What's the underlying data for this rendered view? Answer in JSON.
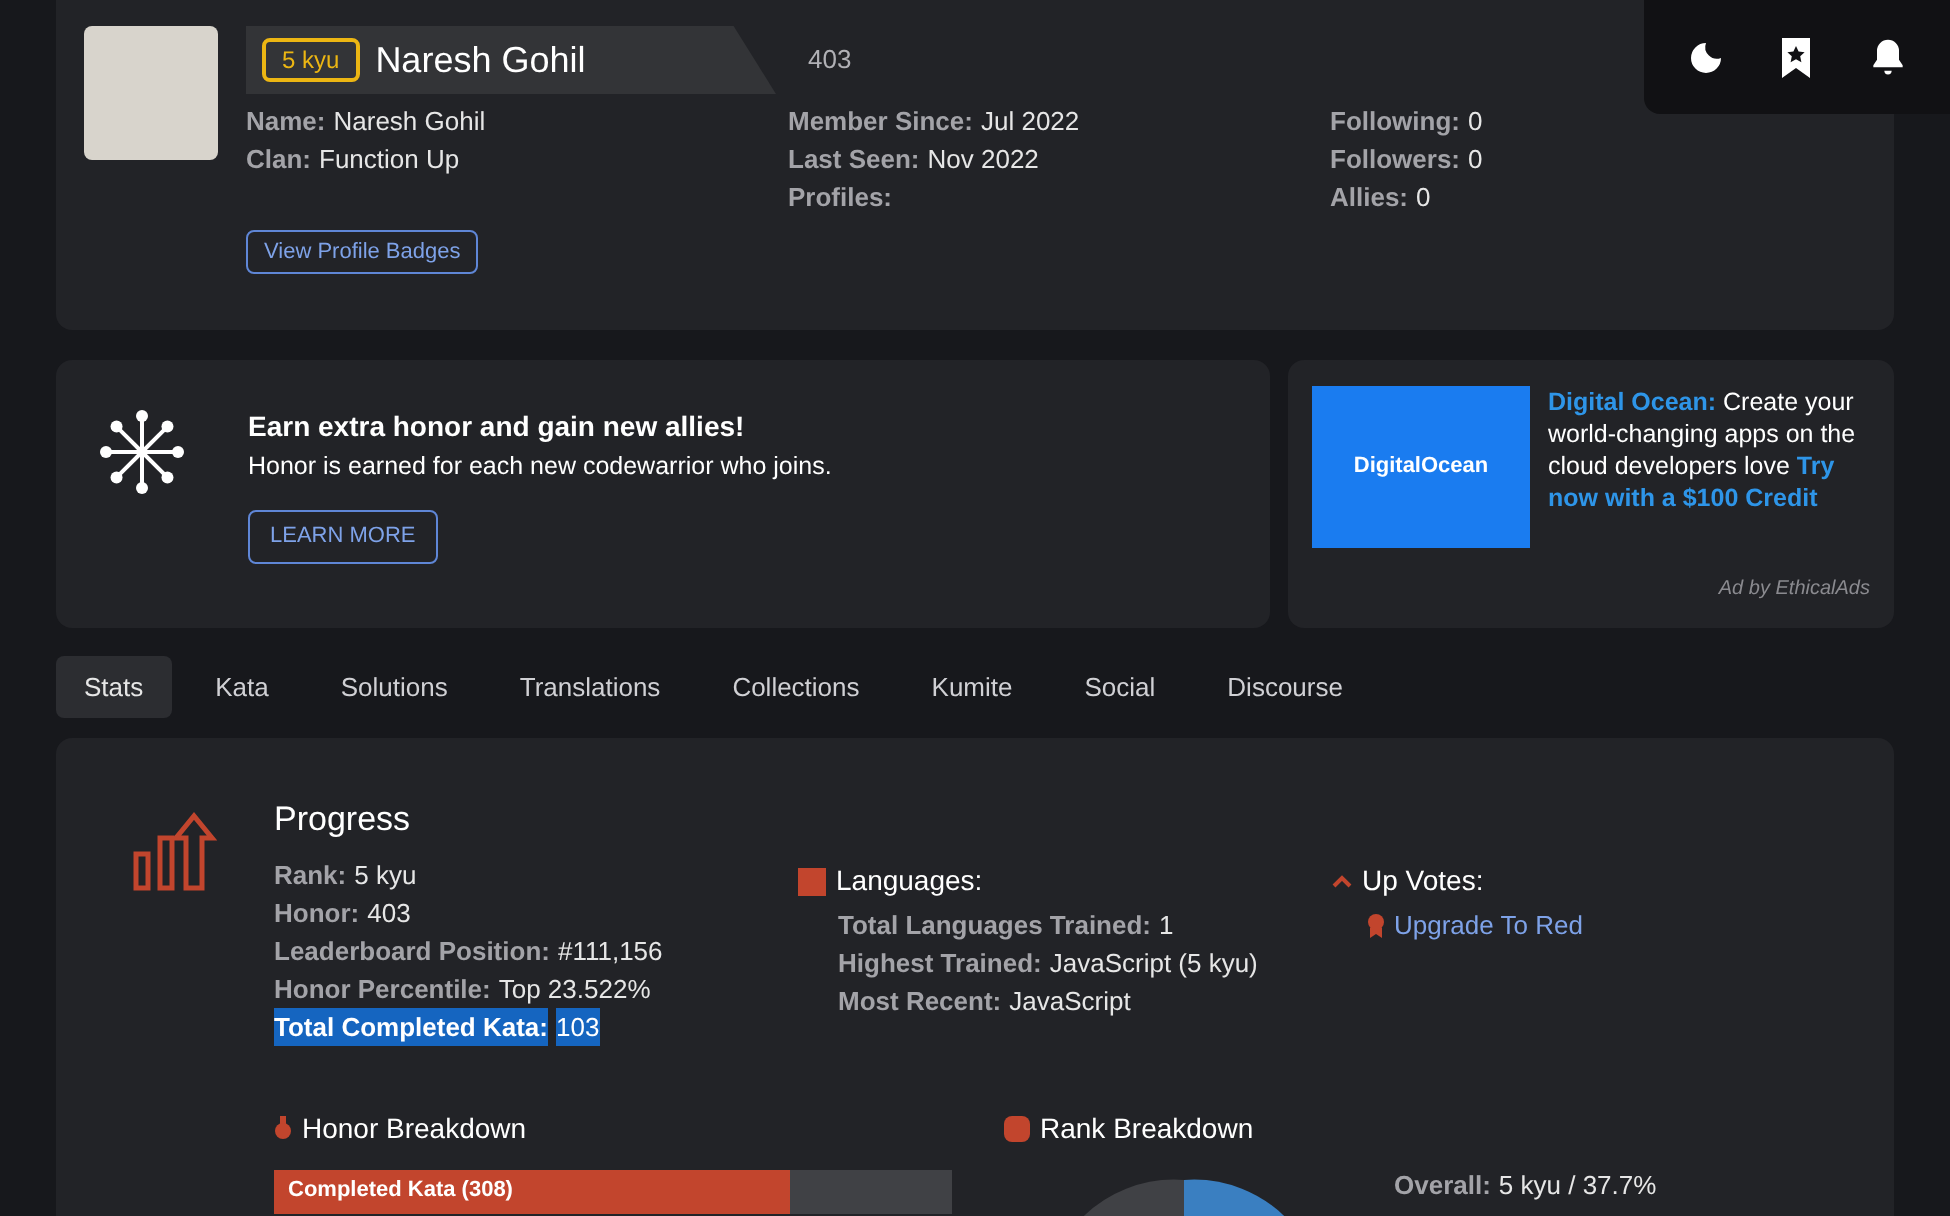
{
  "profile": {
    "rank_badge": "5 kyu",
    "display_name": "Naresh Gohil",
    "honor": "403",
    "columns": [
      [
        {
          "label": "Name:",
          "value": "Naresh Gohil"
        },
        {
          "label": "Clan:",
          "value": "Function Up"
        }
      ],
      [
        {
          "label": "Member Since:",
          "value": "Jul 2022"
        },
        {
          "label": "Last Seen:",
          "value": "Nov 2022"
        },
        {
          "label": "Profiles:"
        }
      ],
      [
        {
          "label": "Following:",
          "value": "0"
        },
        {
          "label": "Followers:",
          "value": "0"
        },
        {
          "label": "Allies:",
          "value": "0"
        }
      ]
    ],
    "badges_button": "View Profile Badges"
  },
  "invite": {
    "title": "Earn extra honor and gain new allies!",
    "text": "Honor is earned for each new codewarrior who joins.",
    "button": "LEARN MORE"
  },
  "ad": {
    "logo_text": "DigitalOcean",
    "headline": "Digital Ocean:",
    "body": "Create your world-changing apps on the cloud developers love",
    "cta": "Try now with a $100 Credit",
    "footer": "Ad by EthicalAds"
  },
  "tabs": [
    {
      "label": "Stats",
      "selected": true
    },
    {
      "label": "Kata",
      "selected": false
    },
    {
      "label": "Solutions",
      "selected": false
    },
    {
      "label": "Translations",
      "selected": false
    },
    {
      "label": "Collections",
      "selected": false
    },
    {
      "label": "Kumite",
      "selected": false
    },
    {
      "label": "Social",
      "selected": false
    },
    {
      "label": "Discourse",
      "selected": false
    }
  ],
  "progress": {
    "title": "Progress",
    "stats": [
      {
        "label": "Rank:",
        "value": "5 kyu",
        "highlighted": false
      },
      {
        "label": "Honor:",
        "value": "403",
        "highlighted": false
      },
      {
        "label": "Leaderboard Position:",
        "value": "#111,156",
        "highlighted": false
      },
      {
        "label": "Honor Percentile:",
        "value": "Top 23.522%",
        "highlighted": false
      },
      {
        "label": "Total Completed Kata:",
        "value": "103",
        "highlighted": true
      }
    ]
  },
  "languages": {
    "title": "Languages:",
    "stats": [
      {
        "label": "Total Languages Trained:",
        "value": "1"
      },
      {
        "label": "Highest Trained:",
        "value": "JavaScript (5 kyu)"
      },
      {
        "label": "Most Recent:",
        "value": "JavaScript"
      }
    ]
  },
  "up_votes": {
    "title": "Up Votes:",
    "link": "Upgrade To Red"
  },
  "honor_breakdown": {
    "title": "Honor Breakdown",
    "bar_label": "Completed Kata (308)",
    "level": 0.76
  },
  "rank_breakdown": {
    "title": "Rank Breakdown",
    "overall_label": "Overall:",
    "overall_value": "5 kyu / 37.7%"
  }
}
